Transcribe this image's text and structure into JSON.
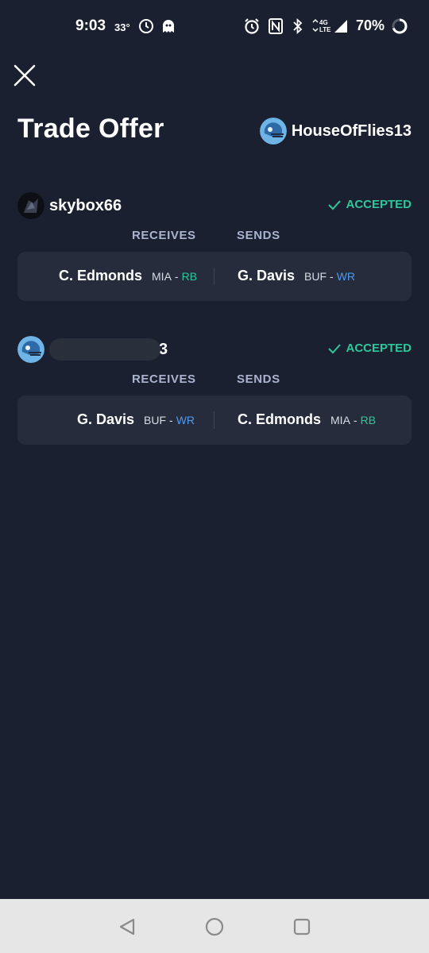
{
  "status_bar": {
    "time": "9:03",
    "temperature": "33°",
    "network": "4G LTE",
    "battery": "70%"
  },
  "header": {
    "title": "Trade Offer",
    "owner": "HouseOfFlies13"
  },
  "trades": [
    {
      "user": "skybox66",
      "status": "ACCEPTED",
      "receives_label": "RECEIVES",
      "sends_label": "SENDS",
      "receives": {
        "name": "C. Edmonds",
        "team": "MIA",
        "sep": "-",
        "pos": "RB"
      },
      "sends": {
        "name": "G. Davis",
        "team": "BUF",
        "sep": "-",
        "pos": "WR"
      }
    },
    {
      "user_visible_tail": "3",
      "status": "ACCEPTED",
      "receives_label": "RECEIVES",
      "sends_label": "SENDS",
      "receives": {
        "name": "G. Davis",
        "team": "BUF",
        "sep": "-",
        "pos": "WR"
      },
      "sends": {
        "name": "C. Edmonds",
        "team": "MIA",
        "sep": "-",
        "pos": "RB"
      }
    }
  ],
  "colors": {
    "background": "#1b2030",
    "card": "#262c3c",
    "accepted": "#2ec79a",
    "rb": "#2ec79a",
    "wr": "#4f9bf0"
  }
}
